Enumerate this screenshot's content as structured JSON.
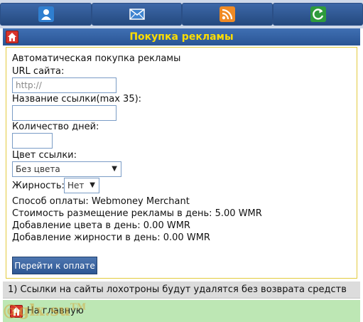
{
  "nav": {
    "icons": [
      "user-icon",
      "mail-icon",
      "rss-icon",
      "refresh-icon"
    ],
    "colors": {
      "user": "#2f7fd0",
      "mail": "#3e84d0",
      "rss": "#f08a24",
      "refresh": "#2e9b3c"
    }
  },
  "header": {
    "title": "Покупка рекламы"
  },
  "form": {
    "heading": "Автоматическая покупка рекламы",
    "url_label": "URL сайта:",
    "url_placeholder": "http://",
    "link_name_label": "Название ссылки(max 35):",
    "days_label": "Количество дней:",
    "color_label": "Цвет ссылки:",
    "color_value": "Без цвета",
    "bold_label": "Жирность:",
    "bold_value": "Нет",
    "payment_method": "Способ оплаты: Webmoney Merchant",
    "price_line": "Стоимость размещение рекламы в день: 5.00 WMR",
    "color_cost": "Добавление цвета в день: 0.00 WMR",
    "bold_cost": "Добавление жирности в день: 0.00 WMR",
    "pay_button": "Перейти к оплате"
  },
  "notice": "1) Ссылки на сайты лохотроны будут удалятся без возврата средств",
  "footer": {
    "home_link": "На главную"
  },
  "watermark": {
    "text": "@glx.su",
    "tm": "TM"
  }
}
